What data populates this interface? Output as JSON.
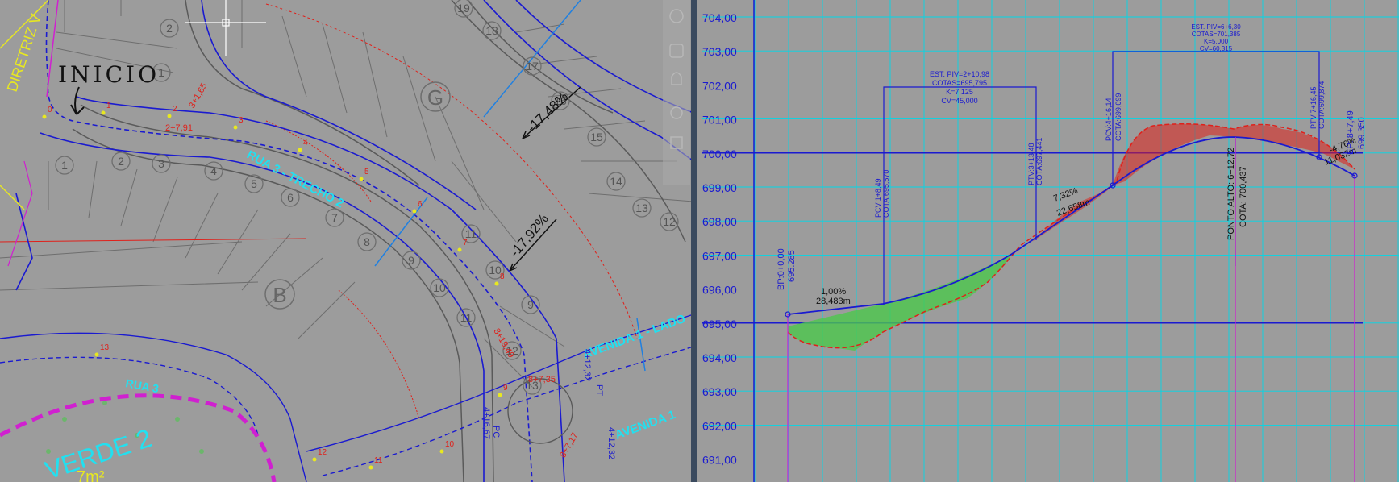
{
  "left_viewport": {
    "name": "plan-view",
    "labels": {
      "inicio": "INICIO",
      "diretriz": "DIRETRIZ V",
      "block_g": "G",
      "block_b": "B",
      "verde": "VERDE 2",
      "area": "7m²",
      "rua_top": "RUA 3 - TRECHO 2",
      "rua_bottom": "RUA 3",
      "avenida1": "AVENIDA 1 - LADO",
      "avenida2": "AVENIDA 1",
      "slope1": "-17,48%",
      "slope2": "-17,92%"
    },
    "lot_numbers_outer_top": [
      "19",
      "18",
      "17",
      "16",
      "15",
      "14",
      "13",
      "12",
      "9",
      "10",
      "11"
    ],
    "lot_numbers_inner": [
      "2",
      "1",
      "1",
      "2",
      "3",
      "4",
      "5",
      "6",
      "7",
      "8",
      "9",
      "10",
      "11",
      "12",
      "13"
    ],
    "stations": [
      "0",
      "1",
      "2",
      "3",
      "4",
      "5",
      "6",
      "7",
      "8",
      "9",
      "10",
      "11",
      "12",
      "13"
    ],
    "station_labels": {
      "s1": "2+7,91",
      "s2": "3+1,65",
      "s3": "8+19,49",
      "s4": "8+7,35",
      "s5": "4+12,32",
      "s6": "4+16,67",
      "s7": "8+7,17",
      "s8": "4+12,32",
      "pc": "PC",
      "pt": "PT"
    }
  },
  "right_viewport": {
    "name": "profile-view",
    "y_axis_labels": [
      "704,00",
      "703,00",
      "702,00",
      "701,00",
      "700,00",
      "699,00",
      "698,00",
      "697,00",
      "696,00",
      "695,00",
      "694,00",
      "693,00",
      "692,00",
      "691,00"
    ],
    "annotations": {
      "bp": "BP:0+0,00",
      "bp_cota": "695.285",
      "seg1_slope": "1,00%",
      "seg1_len": "28,483m",
      "pcv1": "PCV:1+8,49",
      "pcv1_cota": "COTA:695,570",
      "piv1_title": "EST. PIV=2+10,98",
      "piv1_cotas": "COTAS=695,795",
      "piv1_k": "K=7,125",
      "piv1_cv": "CV=45,000",
      "ptv1": "PTV:3+13,48",
      "ptv1_cota": "COTA:697,441",
      "seg2_slope": "7,32%",
      "seg2_len": "22,658m",
      "pcv2": "PCV:4+16,14",
      "pcv2_cota": "COTA:699,099",
      "piv2_title": "EST. PIV=6+6,30",
      "piv2_cotas": "COTAS=701,385",
      "piv2_k": "K=5,000",
      "piv2_cv": "CV=60,315",
      "high_point": "PONTO ALTO: 6+12,72",
      "high_cota": "COTA: 700,437",
      "ptv2": "PTV:7+16,45",
      "ptv2_cota": "COTA:699,874",
      "seg3_slope": "-4,76%",
      "seg3_len": "11,032m",
      "ep": "EP: 8+7,49",
      "ep_cota": "699.350"
    }
  },
  "colors": {
    "background": "#9c9c9c",
    "grid_cyan": "#00d8e8",
    "design_blue": "#1a1ad0",
    "terrain_red": "#e0201a",
    "fill_green": "#4cc84c",
    "magenta": "#d020d0",
    "yellow": "#e8e820",
    "separator": "#3a4a5e"
  }
}
